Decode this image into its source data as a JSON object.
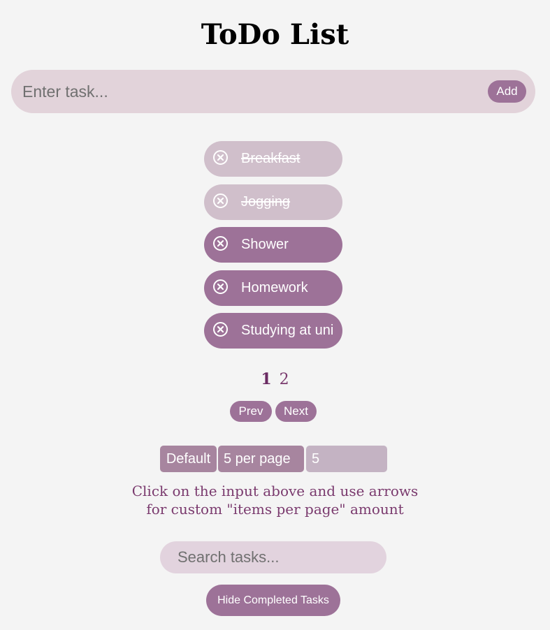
{
  "app": {
    "title": "ToDo List"
  },
  "task_input": {
    "placeholder": "Enter task...",
    "value": "",
    "add_label": "Add"
  },
  "tasks": [
    {
      "label": "Breakfast",
      "completed": true,
      "remove_icon": "close-circle-icon"
    },
    {
      "label": "Jogging",
      "completed": true,
      "remove_icon": "close-circle-icon"
    },
    {
      "label": "Shower",
      "completed": false,
      "remove_icon": "close-circle-icon"
    },
    {
      "label": "Homework",
      "completed": false,
      "remove_icon": "close-circle-icon"
    },
    {
      "label": "Studying at uni",
      "completed": false,
      "remove_icon": "close-circle-icon"
    }
  ],
  "pagination": {
    "pages": [
      "1",
      "2"
    ],
    "current_page": "1",
    "prev_label": "Prev",
    "next_label": "Next"
  },
  "items_per_page": {
    "default_label": "Default",
    "selected_option": "5 per page",
    "number_value": "5",
    "hint_line1": "Click on the input above and use arrows",
    "hint_line2": "for custom \"items per page\" amount"
  },
  "search": {
    "placeholder": "Search tasks...",
    "value": ""
  },
  "hide_completed_label": "Hide Completed Tasks",
  "colors": {
    "background": "#f4f4f4",
    "accent": "#9d7298",
    "completed_task": "#d0bfcb",
    "input_bg": "#e2d3da",
    "text_accent": "#7a3a6e"
  }
}
